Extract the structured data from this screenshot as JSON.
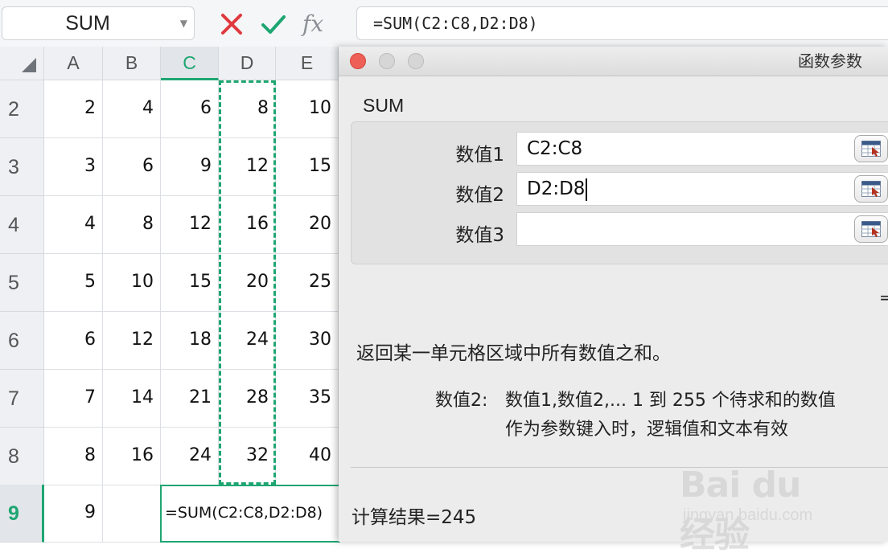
{
  "formula_bar": {
    "name_box": "SUM",
    "formula": "=SUM(C2:C8,D2:D8)",
    "fx_label": "fx",
    "cancel_icon": "close-icon",
    "confirm_icon": "check-icon"
  },
  "columns": [
    "A",
    "B",
    "C",
    "D",
    "E"
  ],
  "rows": [
    {
      "num": "2",
      "cells": [
        "2",
        "4",
        "6",
        "8",
        "10"
      ]
    },
    {
      "num": "3",
      "cells": [
        "3",
        "6",
        "9",
        "12",
        "15"
      ]
    },
    {
      "num": "4",
      "cells": [
        "4",
        "8",
        "12",
        "16",
        "20"
      ]
    },
    {
      "num": "5",
      "cells": [
        "5",
        "10",
        "15",
        "20",
        "25"
      ]
    },
    {
      "num": "6",
      "cells": [
        "6",
        "12",
        "18",
        "24",
        "30"
      ]
    },
    {
      "num": "7",
      "cells": [
        "7",
        "14",
        "21",
        "28",
        "35"
      ]
    },
    {
      "num": "8",
      "cells": [
        "8",
        "16",
        "24",
        "32",
        "40"
      ]
    }
  ],
  "active_row": {
    "num": "9",
    "a": "9",
    "b": "",
    "formula": "=SUM(C2:C8,D2:D8)"
  },
  "dialog": {
    "title": "函数参数",
    "function_name": "SUM",
    "args": [
      {
        "label": "数值1",
        "value": "C2:C8"
      },
      {
        "label": "数值2",
        "value": "D2:D8"
      },
      {
        "label": "数值3",
        "value": ""
      }
    ],
    "equals": "=",
    "description": "返回某一单元格区域中所有数值之和。",
    "arg_desc_label": "数值2:",
    "arg_desc_line1": "数值1,数值2,... 1 到 255 个待求和的数值",
    "arg_desc_line2": "作为参数键入时，逻辑值和文本有效",
    "result": "计算结果=245"
  },
  "watermark": {
    "logo": "Bai du 经验",
    "url": "jingyan.baidu.com"
  },
  "colors": {
    "accent_green": "#1ea672",
    "close_red": "#e0393e",
    "traffic_red": "#ee5f57"
  }
}
